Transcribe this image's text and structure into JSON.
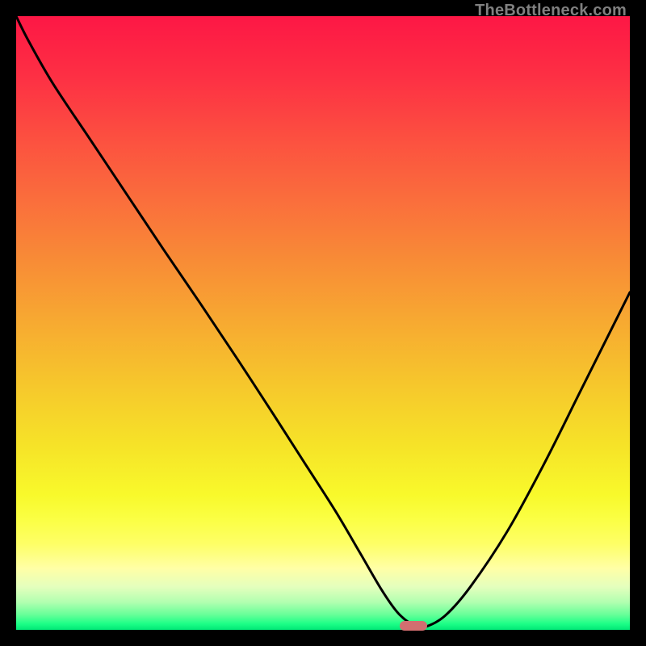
{
  "credit": "TheBottleneck.com",
  "colors": {
    "page_bg": "#000000",
    "credit_text": "#808080",
    "curve_stroke": "#000000",
    "trough_fill": "#d26e70",
    "gradient_stops": [
      {
        "pos": 0.0,
        "color": "#fd1745"
      },
      {
        "pos": 0.1,
        "color": "#fd3044"
      },
      {
        "pos": 0.2,
        "color": "#fc5040"
      },
      {
        "pos": 0.3,
        "color": "#fa6e3c"
      },
      {
        "pos": 0.4,
        "color": "#f88c36"
      },
      {
        "pos": 0.5,
        "color": "#f7aa31"
      },
      {
        "pos": 0.6,
        "color": "#f6c72c"
      },
      {
        "pos": 0.7,
        "color": "#f6e328"
      },
      {
        "pos": 0.78,
        "color": "#f8f92b"
      },
      {
        "pos": 0.82,
        "color": "#fbff44"
      },
      {
        "pos": 0.86,
        "color": "#feff66"
      },
      {
        "pos": 0.9,
        "color": "#ffffa6"
      },
      {
        "pos": 0.93,
        "color": "#e4ffbd"
      },
      {
        "pos": 0.955,
        "color": "#b1ffb0"
      },
      {
        "pos": 0.975,
        "color": "#68ff99"
      },
      {
        "pos": 0.99,
        "color": "#1dff87"
      },
      {
        "pos": 1.0,
        "color": "#00e777"
      }
    ]
  },
  "chart_data": {
    "type": "line",
    "title": "",
    "xlabel": "",
    "ylabel": "",
    "xlim": [
      0,
      100
    ],
    "ylim": [
      0,
      100
    ],
    "grid": false,
    "legend": false,
    "series": [
      {
        "name": "bottleneck-curve",
        "x": [
          0,
          2,
          6,
          12,
          18,
          24,
          30,
          36,
          42,
          47,
          52,
          56,
          59.5,
          62,
          64,
          65.5,
          67,
          70,
          74,
          80,
          86,
          92,
          98,
          100
        ],
        "values": [
          100,
          96,
          89,
          80,
          71,
          62,
          53.2,
          44.2,
          35,
          27.2,
          19.4,
          12.6,
          6.6,
          3.0,
          1.2,
          0.6,
          0.6,
          2.4,
          7.0,
          16,
          27,
          39,
          51,
          55
        ]
      }
    ],
    "trough_marker": {
      "x_start": 62.5,
      "x_end": 67,
      "y": 0.6
    }
  }
}
